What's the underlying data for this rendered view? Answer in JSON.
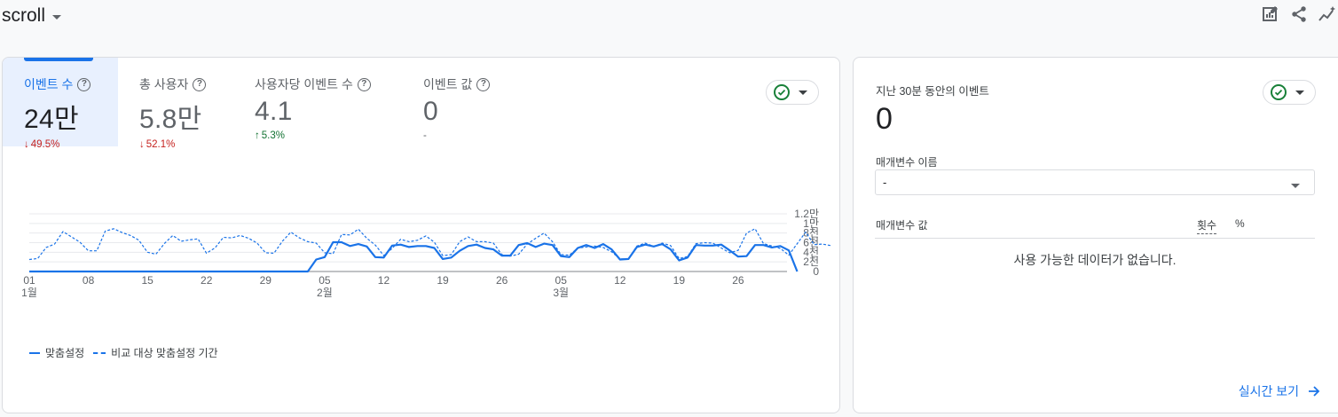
{
  "header": {
    "title": "scroll"
  },
  "metrics": [
    {
      "label": "이벤트 수",
      "value": "24만",
      "change": "49.5%",
      "dir": "down",
      "active": true
    },
    {
      "label": "총 사용자",
      "value": "5.8만",
      "change": "52.1%",
      "dir": "down",
      "active": false
    },
    {
      "label": "사용자당 이벤트 수",
      "value": "4.1",
      "change": "5.3%",
      "dir": "up",
      "active": false
    },
    {
      "label": "이벤트 값",
      "value": "0",
      "change": "-",
      "dir": "none",
      "active": false
    }
  ],
  "legend": {
    "current": "맞춤설정",
    "compare": "비교 대상 맞춤설정 기간"
  },
  "chart_data": {
    "type": "line",
    "x_tick_labels": [
      "01",
      "08",
      "15",
      "22",
      "29",
      "05",
      "12",
      "19",
      "26",
      "05",
      "12",
      "19",
      "26"
    ],
    "x_tick_days": [
      1,
      8,
      15,
      22,
      29,
      36,
      43,
      50,
      57,
      64,
      71,
      78,
      85
    ],
    "month_labels": [
      {
        "day": 1,
        "label": "1월"
      },
      {
        "day": 36,
        "label": "2월"
      },
      {
        "day": 64,
        "label": "3월"
      }
    ],
    "y_tick_labels": [
      "0",
      "2천",
      "4천",
      "6천",
      "8천",
      "1만",
      "1.2만"
    ],
    "y_ticks": [
      0,
      2000,
      4000,
      6000,
      8000,
      10000,
      12000
    ],
    "ylim": [
      0,
      12000
    ],
    "x_domain": [
      1,
      91
    ],
    "series": [
      {
        "name": "맞춤설정",
        "style": "solid",
        "color": "#1a73e8",
        "values": [
          0,
          0,
          0,
          0,
          0,
          0,
          0,
          0,
          0,
          0,
          0,
          0,
          0,
          0,
          0,
          0,
          0,
          0,
          0,
          0,
          0,
          0,
          0,
          0,
          0,
          0,
          0,
          0,
          0,
          0,
          0,
          0,
          0,
          0,
          2500,
          3000,
          6100,
          6100,
          5300,
          5700,
          5200,
          3000,
          2900,
          5400,
          5600,
          5100,
          5300,
          5300,
          4900,
          2600,
          2900,
          4300,
          5300,
          5600,
          4900,
          4600,
          3300,
          3300,
          5500,
          5900,
          5100,
          5800,
          5500,
          3200,
          3000,
          4900,
          5500,
          4900,
          5700,
          4600,
          2500,
          2600,
          5100,
          5600,
          5200,
          5700,
          4600,
          2300,
          2900,
          5500,
          5400,
          5400,
          5600,
          4400,
          3100,
          3200,
          5500,
          5500,
          5000,
          5300,
          4400,
          0
        ]
      },
      {
        "name": "비교 대상 맞춤설정 기간",
        "style": "dashed",
        "color": "#1a73e8",
        "values": [
          2500,
          2700,
          5000,
          5700,
          8300,
          7200,
          6100,
          4300,
          4300,
          8400,
          8900,
          8100,
          7500,
          6500,
          4000,
          3600,
          5800,
          7500,
          6300,
          6600,
          6800,
          3800,
          4900,
          7100,
          7000,
          7500,
          6900,
          5900,
          3900,
          3800,
          6300,
          8200,
          7000,
          6200,
          5900,
          3900,
          3700,
          7700,
          7600,
          8800,
          6900,
          5500,
          3300,
          4800,
          6700,
          6200,
          6500,
          7400,
          6100,
          3300,
          3500,
          6200,
          7200,
          6200,
          6200,
          5900,
          3500,
          3200,
          3600,
          5700,
          6900,
          8000,
          6200,
          3500,
          3400,
          4900,
          5100,
          5300,
          5000,
          4100,
          2600,
          2600,
          5300,
          5900,
          5200,
          5900,
          5400,
          2700,
          3100,
          5800,
          6000,
          5900,
          4900,
          3900,
          4400,
          8000,
          8900,
          5800,
          5300,
          4800,
          3400,
          5800,
          8200,
          5600,
          5700,
          5400
        ]
      }
    ]
  },
  "side": {
    "title": "지난 30분 동안의 이벤트",
    "value": "0",
    "param_label": "매개변수 이름",
    "param_selected": "-",
    "col_name": "매개변수 값",
    "col_count": "횟수",
    "col_pct": "%",
    "empty": "사용 가능한 데이터가 없습니다.",
    "realtime_link": "실시간 보기"
  },
  "icons": [
    "edit-chart-icon",
    "share-icon",
    "insights-icon",
    "help-icon",
    "check-circle-icon",
    "arrow-right-icon"
  ],
  "colors": {
    "accent": "#1a73e8",
    "down": "#c5221f",
    "up": "#137333",
    "active_bg": "#e8f0fe"
  }
}
